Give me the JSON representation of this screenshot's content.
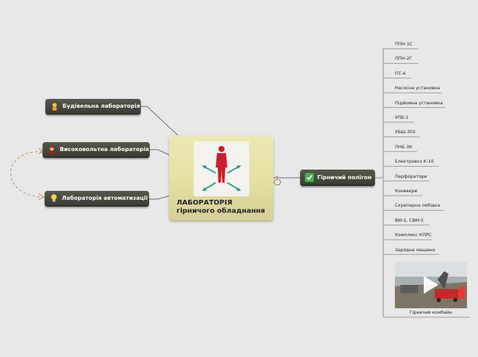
{
  "central": {
    "title_line1": "ЛАБОРАТОРІЯ",
    "title_line2": "гірничого обладнання",
    "icon": "people-network-icon"
  },
  "left_branches": [
    {
      "label": "Будівельна лабораторія",
      "icon": "construction-worker-icon"
    },
    {
      "label": "Високовольтна лабораторія",
      "icon": "firefighter-icon"
    },
    {
      "label": "Лабораторія автоматизації",
      "icon": "light-bulb-icon"
    }
  ],
  "right_branch": {
    "label": "Гірничий полігон",
    "icon": "check-mark-icon",
    "collapse_count": "-",
    "items": [
      "ППН-1С",
      "ППН-2Г",
      "ПТ-4",
      "Насосна установка",
      "Підйомна установка",
      "УПБ-1",
      "УБШ-302",
      "ПНБ-3К",
      "Електровоз К-10",
      "Перфоратори",
      "Конвеєри",
      "Скреперна лебідка",
      "ВМ-5, СВМ-5",
      "Комплекс КПРС",
      "Зарядна машина"
    ],
    "video_caption": "Гірничий комбайн"
  },
  "colors": {
    "node_bg": "#4a493f",
    "central_bg": "#e7e2a6",
    "figure_red": "#cc1f2d",
    "arrow_teal": "#2a9d8f",
    "relation_dashed": "#c9a98a",
    "check_green": "#44b34a"
  }
}
